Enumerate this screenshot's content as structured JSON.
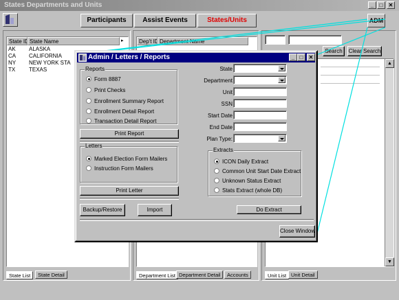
{
  "main_window": {
    "title": "States Departments and Units",
    "controls": {
      "minimize": "_",
      "maximize": "□",
      "close": "✕"
    }
  },
  "nav": {
    "participants": "Participants",
    "assist_events": "Assist Events",
    "states_units": "States/Units",
    "adm": "ADM"
  },
  "colors": {
    "active_nav": "#e00000",
    "title_active": "#000080",
    "callout_line": "#00e0e0"
  },
  "states_panel": {
    "columns": [
      "State ID",
      "State Name"
    ],
    "rows": [
      [
        "AK",
        "ALASKA"
      ],
      [
        "CA",
        "CALIFORNIA"
      ],
      [
        "NY",
        "NEW YORK STA"
      ],
      [
        "TX",
        "TEXAS"
      ]
    ],
    "tabs": [
      "State List",
      "State Detail"
    ]
  },
  "dept_panel": {
    "columns": [
      "Dep't ID",
      "Department Name"
    ],
    "tabs": [
      "Department List",
      "Department Detail",
      "Accounts"
    ]
  },
  "unit_panel": {
    "search_label": "Search",
    "clear_label": "Clear Search",
    "tabs": [
      "Unit List",
      "Unit Detail"
    ]
  },
  "dialog": {
    "title": "Admin / Letters / Reports",
    "controls": {
      "minimize": "_",
      "maximize": "□",
      "close": "✕"
    },
    "reports": {
      "label": "Reports",
      "options": [
        "Form 8887",
        "Print Checks",
        "Enrollment Summary Report",
        "Enrollment Detail Report",
        "Transaction Detail Report"
      ],
      "selected": 0
    },
    "print_report": "Print Report",
    "letters": {
      "label": "Letters",
      "options": [
        "Marked Election Form Mailers",
        "Instruction Form Mailers"
      ],
      "selected": 0
    },
    "print_letter": "Print Letter",
    "backup_restore": "Backup/Restore",
    "import": "Import",
    "fields": {
      "state": "State",
      "department": "Department",
      "unit": "Unit",
      "ssn": "SSN",
      "start_date": "Start Date",
      "end_date": "End Date",
      "plan_type": "Plan Type:"
    },
    "extracts": {
      "label": "Extracts",
      "options": [
        "ICON Daily Extract",
        "Common Unit Start Date Extract",
        "Unknown Status Extract",
        "Stats Extract (whole DB)"
      ],
      "selected": 0
    },
    "do_extract": "Do Extract",
    "close_window": "Close Window"
  }
}
